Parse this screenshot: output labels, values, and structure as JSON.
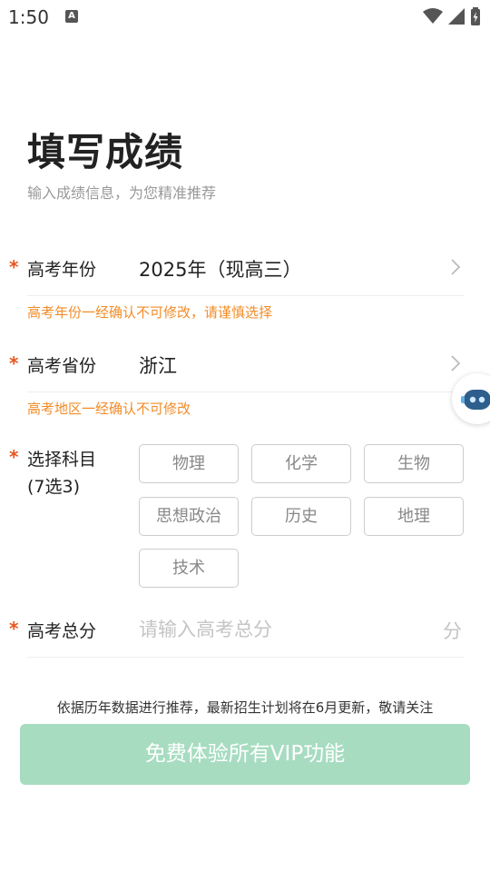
{
  "status_bar": {
    "time": "1:50",
    "notification_icon": "A"
  },
  "header": {
    "title": "填写成绩",
    "subtitle": "输入成绩信息，为您精准推荐"
  },
  "required_mark": "*",
  "year_field": {
    "label": "高考年份",
    "value": "2025年（现高三）",
    "hint": "高考年份一经确认不可修改，请谨慎选择"
  },
  "province_field": {
    "label": "高考省份",
    "value": "浙江",
    "hint": "高考地区一经确认不可修改"
  },
  "subjects_field": {
    "label_line1": "选择科目",
    "label_line2": "(7选3)",
    "options": [
      "物理",
      "化学",
      "生物",
      "思想政治",
      "历史",
      "地理",
      "技术"
    ]
  },
  "score_field": {
    "label": "高考总分",
    "placeholder": "请输入高考总分",
    "value": "",
    "unit": "分"
  },
  "notice": "依据历年数据进行推荐，最新招生计划将在6月更新，敬请关注",
  "vip_button": {
    "label": "免费体验所有VIP功能"
  },
  "colors": {
    "accent_required": "#e8551f",
    "hint": "#f28c28",
    "button_bg": "#a7dcc0",
    "assistant_icon": "#2e5e8c"
  },
  "icons": [
    "wifi-icon",
    "signal-icon",
    "battery-icon",
    "chevron-right-icon",
    "assistant-robot-icon"
  ]
}
